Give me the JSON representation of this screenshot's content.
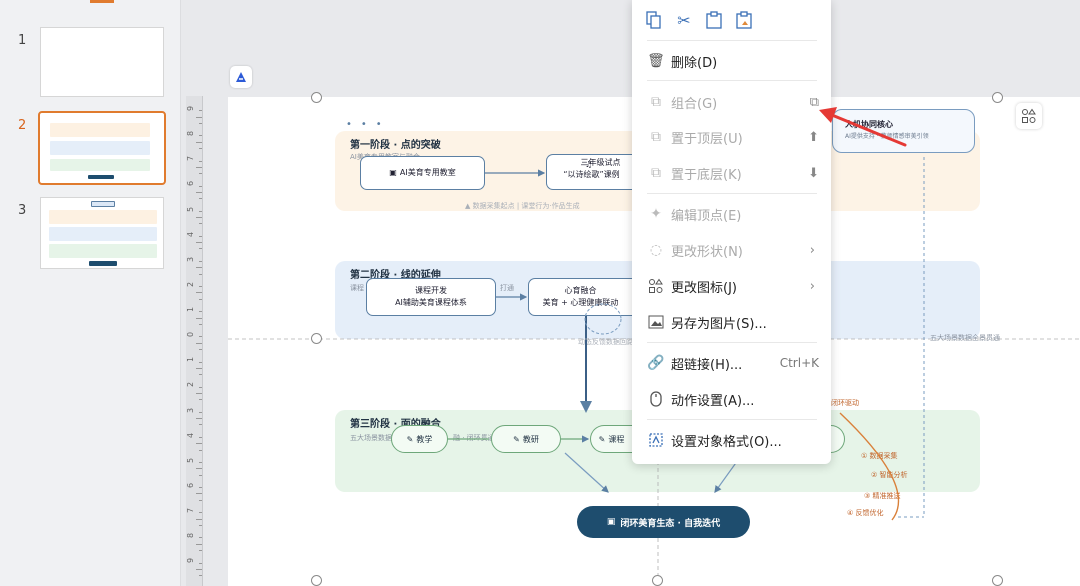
{
  "thumbnails": [
    {
      "number": "1"
    },
    {
      "number": "2"
    },
    {
      "number": "3"
    }
  ],
  "ruler": {
    "labels": [
      "9",
      "8",
      "7",
      "6",
      "5",
      "4",
      "3",
      "2",
      "1",
      "0",
      "1",
      "2",
      "3",
      "4",
      "5",
      "6",
      "7",
      "8",
      "9"
    ]
  },
  "slide": {
    "stage1": {
      "title": "第一阶段 · 点的突破",
      "sub": "AI美育专用教室与融合",
      "box1": "AI美育专用教室",
      "box2_l1": "三年级试点",
      "box2_l2": "“以诗绘歌”课例",
      "footer": "▲ 数据采集起点 | 课堂行为·作品生成"
    },
    "stage2": {
      "title": "第二阶段 · 线的延伸",
      "sub": "课程",
      "tag": "打通",
      "box1_l1": "课程开发",
      "box1_l2": "AI辅助美育课程体系",
      "box2_l1": "心育融合",
      "box2_l2": "美育 + 心理健康联动",
      "note": "动态反馈数据回路"
    },
    "stage3": {
      "title": "第三阶段 · 面的融合",
      "sub": "五大场景数据",
      "b1": "教学",
      "b2": "教研",
      "b3": "课程",
      "mid": "融 · 闭环贯通",
      "loop": "闭环驱动",
      "steps": [
        "① 数据采集",
        "② 智能分析",
        "③ 精准推送",
        "④ 反馈优化"
      ],
      "final": "闭环美育生态 · 自我迭代"
    },
    "core": {
      "title": "人机协同核心",
      "sub": "AI提供支持 · 教师情感审美引领"
    },
    "dash_label": "五大场景数据全景贯通"
  },
  "menu": {
    "delete": "删除(D)",
    "group": "组合(G)",
    "bring_front": "置于顶层(U)",
    "send_back": "置于底层(K)",
    "edit_points": "编辑顶点(E)",
    "change_shape": "更改形状(N)",
    "change_icon": "更改图标(J)",
    "save_as_image": "另存为图片(S)...",
    "hyperlink": "超链接(H)...",
    "hyperlink_shortcut": "Ctrl+K",
    "action": "动作设置(A)...",
    "format": "设置对象格式(O)..."
  },
  "colors": {
    "accent": "#e07b2e",
    "arrow": "#e53935",
    "navy": "#1e4d6e"
  }
}
